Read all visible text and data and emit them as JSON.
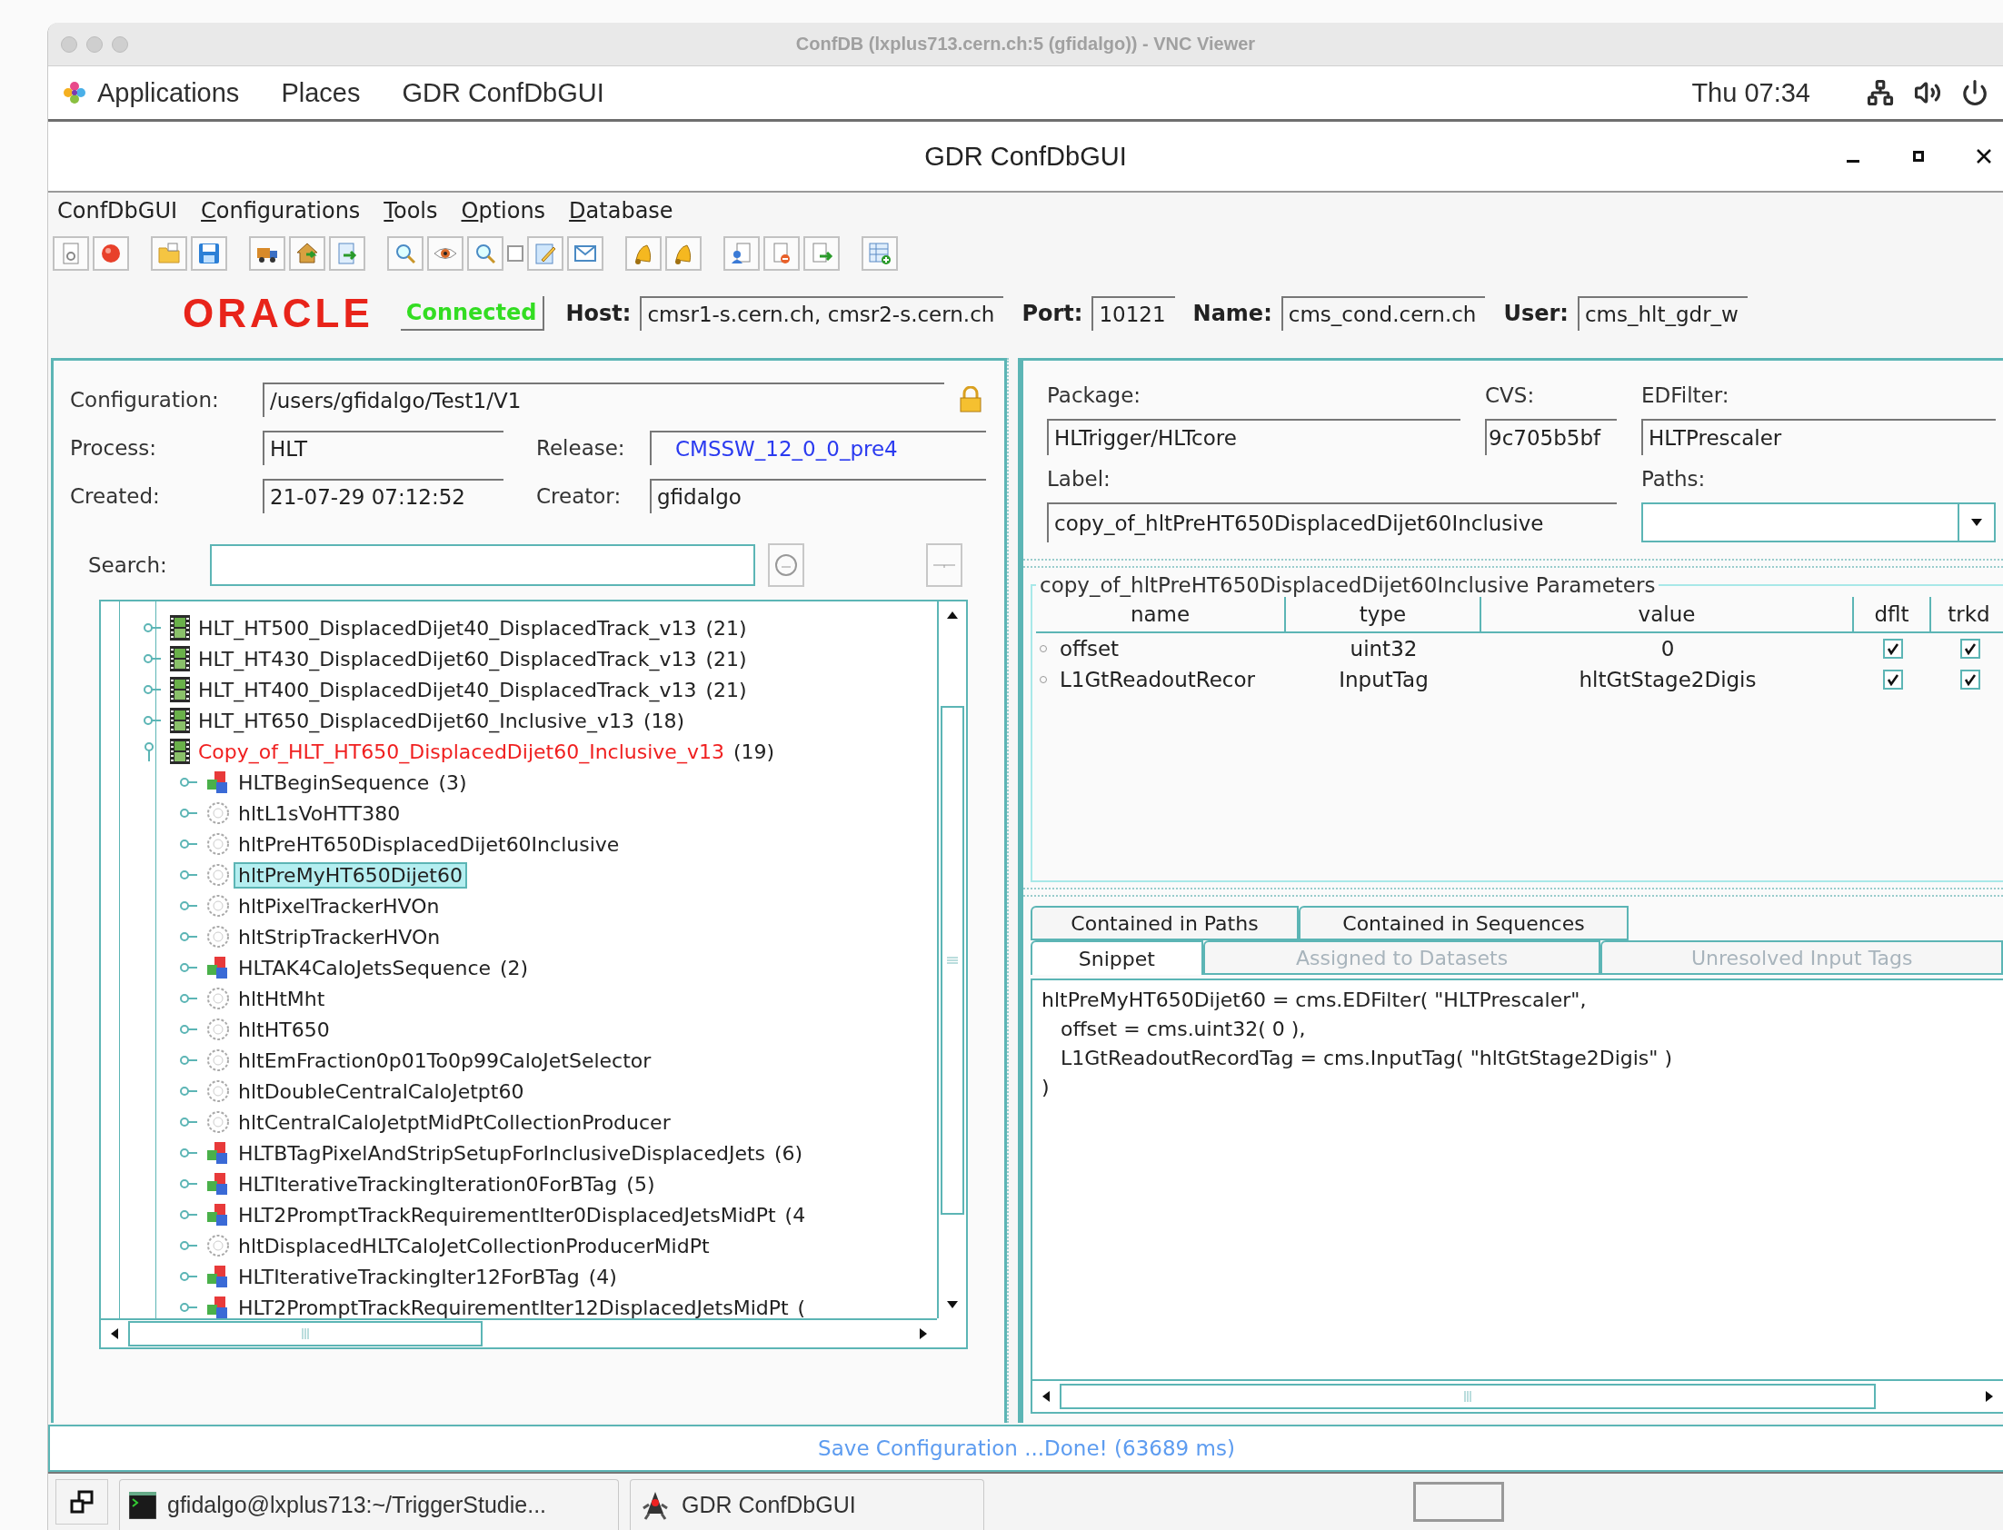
{
  "vnc_window": {
    "title": "ConfDB (lxplus713.cern.ch:5 (gfidalgo)) - VNC Viewer"
  },
  "top_bar": {
    "menus": [
      "Applications",
      "Places",
      "GDR ConfDbGUI"
    ],
    "clock": "Thu 07:34"
  },
  "app_window": {
    "title": "GDR ConfDbGUI"
  },
  "menu_bar": [
    {
      "label": "ConfDbGUI",
      "underlined": false
    },
    {
      "label": "Configurations",
      "underlined": true
    },
    {
      "label": "Tools",
      "underlined": true
    },
    {
      "label": "Options",
      "underlined": true
    },
    {
      "label": "Database",
      "underlined": true
    }
  ],
  "connection": {
    "vendor_logo": "ORACLE",
    "status": "Connected",
    "fields": [
      {
        "label": "Host:",
        "value": "cmsr1-s.cern.ch, cmsr2-s.cern.ch"
      },
      {
        "label": "Port:",
        "value": "10121"
      },
      {
        "label": "Name:",
        "value": "cms_cond.cern.ch"
      },
      {
        "label": "User:",
        "value": "cms_hlt_gdr_w"
      }
    ]
  },
  "configuration_panel": {
    "configuration": {
      "label": "Configuration:",
      "value": "/users/gfidalgo/Test1/V1",
      "locked": true
    },
    "process": {
      "label": "Process:",
      "value": "HLT"
    },
    "release": {
      "label": "Release:",
      "value": "CMSSW_12_0_0_pre4"
    },
    "created": {
      "label": "Created:",
      "value": "21-07-29 07:12:52"
    },
    "creator": {
      "label": "Creator:",
      "value": "gfidalgo"
    }
  },
  "search": {
    "label": "Search:"
  },
  "tree": {
    "items": [
      {
        "label": "HLT_HT500_DisplacedDijet40_DisplacedTrack_v13",
        "count": "(21)",
        "kind": "path",
        "expanded": false,
        "modified": false,
        "selected": false
      },
      {
        "label": "HLT_HT430_DisplacedDijet60_DisplacedTrack_v13",
        "count": "(21)",
        "kind": "path",
        "expanded": false,
        "modified": false,
        "selected": false
      },
      {
        "label": "HLT_HT400_DisplacedDijet40_DisplacedTrack_v13",
        "count": "(21)",
        "kind": "path",
        "expanded": false,
        "modified": false,
        "selected": false
      },
      {
        "label": "HLT_HT650_DisplacedDijet60_Inclusive_v13",
        "count": "(18)",
        "kind": "path",
        "expanded": false,
        "modified": false,
        "selected": false
      },
      {
        "label": "Copy_of_HLT_HT650_DisplacedDijet60_Inclusive_v13",
        "count": "(19)",
        "kind": "path",
        "expanded": true,
        "modified": true,
        "selected": false,
        "children": [
          {
            "label": "HLTBeginSequence",
            "count": "(3)",
            "kind": "sequence",
            "expanded": false,
            "modified": false,
            "selected": false
          },
          {
            "label": "hltL1sVoHTT380",
            "kind": "module",
            "expanded": false,
            "modified": false,
            "selected": false
          },
          {
            "label": "hltPreHT650DisplacedDijet60Inclusive",
            "kind": "module",
            "expanded": false,
            "modified": false,
            "selected": false
          },
          {
            "label": "hltPreMyHT650Dijet60",
            "kind": "module",
            "expanded": false,
            "modified": false,
            "selected": true
          },
          {
            "label": "hltPixelTrackerHVOn",
            "kind": "module",
            "expanded": false,
            "modified": false,
            "selected": false
          },
          {
            "label": "hltStripTrackerHVOn",
            "kind": "module",
            "expanded": false,
            "modified": false,
            "selected": false
          },
          {
            "label": "HLTAK4CaloJetsSequence",
            "count": "(2)",
            "kind": "sequence",
            "expanded": false,
            "modified": false,
            "selected": false
          },
          {
            "label": "hltHtMht",
            "kind": "module",
            "expanded": false,
            "modified": false,
            "selected": false
          },
          {
            "label": "hltHT650",
            "kind": "module",
            "expanded": false,
            "modified": false,
            "selected": false
          },
          {
            "label": "hltEmFraction0p01To0p99CaloJetSelector",
            "kind": "module",
            "expanded": false,
            "modified": false,
            "selected": false
          },
          {
            "label": "hltDoubleCentralCaloJetpt60",
            "kind": "module",
            "expanded": false,
            "modified": false,
            "selected": false
          },
          {
            "label": "hltCentralCaloJetptMidPtCollectionProducer",
            "kind": "module",
            "expanded": false,
            "modified": false,
            "selected": false
          },
          {
            "label": "HLTBTagPixelAndStripSetupForInclusiveDisplacedJets",
            "count": "(6)",
            "kind": "sequence",
            "expanded": false,
            "modified": false,
            "selected": false
          },
          {
            "label": "HLTIterativeTrackingIteration0ForBTag",
            "count": "(5)",
            "kind": "sequence",
            "expanded": false,
            "modified": false,
            "selected": false
          },
          {
            "label": "HLT2PromptTrackRequirementIter0DisplacedJetsMidPt",
            "count": "(4",
            "kind": "sequence",
            "expanded": false,
            "modified": false,
            "selected": false
          },
          {
            "label": "hltDisplacedHLTCaloJetCollectionProducerMidPt",
            "kind": "module",
            "expanded": false,
            "modified": false,
            "selected": false
          },
          {
            "label": "HLTIterativeTrackingIter12ForBTag",
            "count": "(4)",
            "kind": "sequence",
            "expanded": false,
            "modified": false,
            "selected": false
          },
          {
            "label": "HLT2PromptTrackRequirementIter12DisplacedJetsMidPt",
            "count": "(",
            "kind": "sequence",
            "expanded": false,
            "modified": false,
            "selected": false
          }
        ]
      }
    ]
  },
  "module_details": {
    "package": {
      "label": "Package:",
      "value": "HLTrigger/HLTcore"
    },
    "cvs": {
      "label": "CVS:",
      "value": "9c705b5bf"
    },
    "edfilter": {
      "label": "EDFilter:",
      "value": "HLTPrescaler"
    },
    "label": {
      "label": "Label:",
      "value": "copy_of_hltPreHT650DisplacedDijet60Inclusive"
    },
    "paths": {
      "label": "Paths:"
    }
  },
  "parameters": {
    "title": "copy_of_hltPreHT650DisplacedDijet60Inclusive Parameters",
    "columns": [
      "name",
      "type",
      "value",
      "dflt",
      "trkd"
    ],
    "rows": [
      {
        "name": "offset",
        "type": "uint32",
        "value": "0",
        "dflt": true,
        "trkd": true
      },
      {
        "name": "L1GtReadoutRecor",
        "type": "InputTag",
        "value": "hltGtStage2Digis",
        "dflt": true,
        "trkd": true
      }
    ]
  },
  "tabs": {
    "rows": [
      [
        {
          "label": "Contained in Paths",
          "selected": false,
          "disabled": false
        },
        {
          "label": "Contained in Sequences",
          "selected": false,
          "disabled": false
        }
      ],
      [
        {
          "label": "Snippet",
          "selected": true,
          "disabled": false
        },
        {
          "label": "Assigned to Datasets",
          "selected": false,
          "disabled": true
        },
        {
          "label": "Unresolved Input Tags",
          "selected": false,
          "disabled": true
        }
      ]
    ]
  },
  "snippet": {
    "lines": [
      "hltPreMyHT650Dijet60 = cms.EDFilter( \"HLTPrescaler\",",
      "   offset = cms.uint32( 0 ),",
      "   L1GtReadoutRecordTag = cms.InputTag( \"hltGtStage2Digis\" )",
      ")"
    ]
  },
  "status_bar": "Save Configuration ...Done! (63689 ms)",
  "taskbar": {
    "tasks": [
      {
        "label": "gfidalgo@lxplus713:~/TriggerStudie...",
        "kind": "terminal"
      },
      {
        "label": "GDR ConfDbGUI",
        "kind": "app"
      }
    ]
  }
}
